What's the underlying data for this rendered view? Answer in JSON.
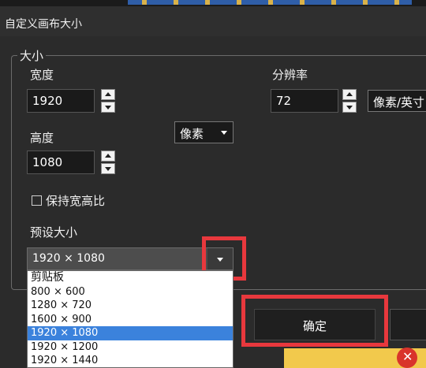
{
  "dialog": {
    "title": "自定义画布大小"
  },
  "size_group": {
    "label": "大小",
    "width_label": "宽度",
    "width_value": "1920",
    "height_label": "高度",
    "height_value": "1080",
    "unit_select": "像素",
    "resolution_label": "分辨率",
    "resolution_value": "72",
    "resolution_unit": "像素/英寸",
    "keep_ratio_label": "保持宽高比",
    "keep_ratio_checked": false,
    "preset_label": "预设大小",
    "preset_selected": "1920 × 1080",
    "preset_options": [
      "剪贴板",
      "800 × 600",
      "1280 × 720",
      "1600 × 900",
      "1920 × 1080",
      "1920 × 1200",
      "1920 × 1440"
    ],
    "highlighted_option_index": 4
  },
  "buttons": {
    "ok": "确定"
  },
  "colors": {
    "background": "#2b2b2b",
    "highlight_box": "#e8383d",
    "selected_option": "#3b82dc",
    "error_icon": "#d9342b",
    "bottom_bar": "#f2c94c"
  },
  "icons": {
    "error": "close-x-icon"
  }
}
